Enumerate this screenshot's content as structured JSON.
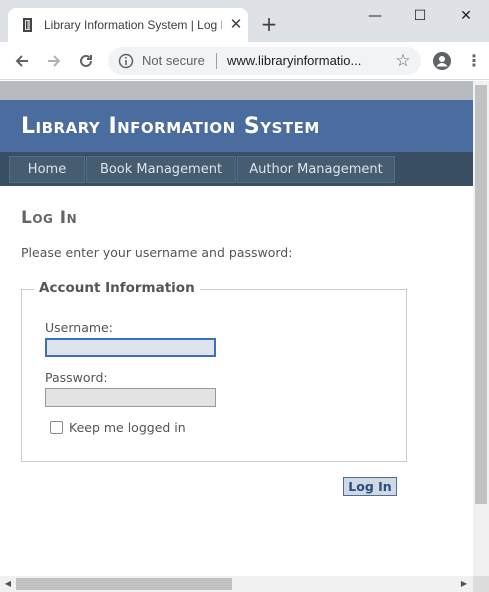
{
  "browser": {
    "tab_title": "Library Information System | Log In",
    "close_tab_glyph": "✕",
    "new_tab_glyph": "+",
    "window_controls": {
      "minimize": "—",
      "maximize": "☐",
      "close": "✕"
    },
    "security_label": "Not secure",
    "url": "www.libraryinformatio..."
  },
  "site": {
    "title": "Library Information System",
    "menu": [
      {
        "label": "Home"
      },
      {
        "label": "Book Management"
      },
      {
        "label": "Author Management"
      }
    ]
  },
  "login": {
    "page_title": "Log In",
    "instructions": "Please enter your username and password:",
    "fieldset_legend": "Account Information",
    "username_label": "Username:",
    "username_value": "",
    "password_label": "Password:",
    "password_value": "",
    "remember_label": "Keep me logged in",
    "remember_checked": false,
    "submit_label": "Log In"
  },
  "colors": {
    "header_bg": "#4b6c9e",
    "menu_bg": "#3a4f63",
    "menu_item_bg": "#465c71",
    "button_bg": "#cfd8e3"
  }
}
